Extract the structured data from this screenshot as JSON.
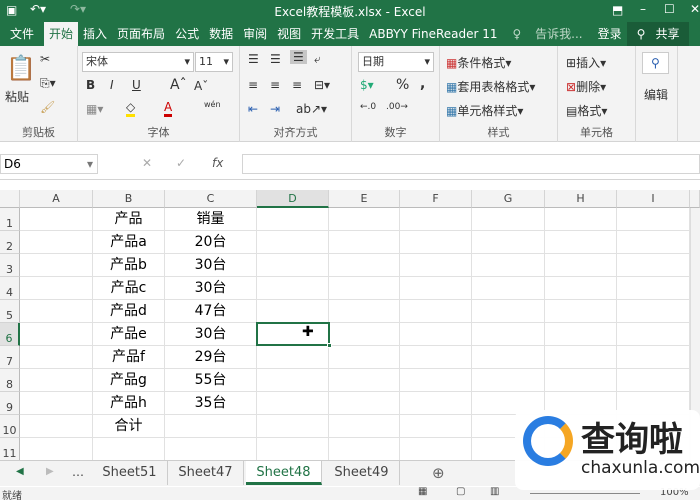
{
  "title": "Excel教程模板.xlsx - Excel",
  "tabs": [
    "文件",
    "开始",
    "插入",
    "页面布局",
    "公式",
    "数据",
    "审阅",
    "视图",
    "开发工具",
    "ABBYY FineReader 11",
    "告诉我...",
    "登录",
    "共享"
  ],
  "ribbon": {
    "clipboard": {
      "paste": "粘贴",
      "label": "剪贴板"
    },
    "font": {
      "name": "宋体",
      "size": "11",
      "label": "字体",
      "bold": "B",
      "italic": "I",
      "underline": "U",
      "phonetic": "wén"
    },
    "align": {
      "label": "对齐方式"
    },
    "number": {
      "format": "日期",
      "percent": "%",
      "comma": ",",
      "label": "数字"
    },
    "styles": {
      "cond": "条件格式",
      "table": "套用表格格式",
      "cell": "单元格样式",
      "label": "样式"
    },
    "cells": {
      "insert": "插入",
      "delete": "删除",
      "format": "格式",
      "label": "单元格"
    },
    "edit": {
      "label": "编辑"
    }
  },
  "formula": {
    "name_box": "D6",
    "fx": "fx",
    "value": ""
  },
  "columns": [
    "A",
    "B",
    "C",
    "D",
    "E",
    "F",
    "G",
    "H",
    "I"
  ],
  "rows": [
    "1",
    "2",
    "3",
    "4",
    "5",
    "6",
    "7",
    "8",
    "9",
    "10",
    "11"
  ],
  "data": [
    [
      "产品",
      "销量"
    ],
    [
      "产品a",
      "20台"
    ],
    [
      "产品b",
      "30台"
    ],
    [
      "产品c",
      "30台"
    ],
    [
      "产品d",
      "47台"
    ],
    [
      "产品e",
      "30台"
    ],
    [
      "产品f",
      "29台"
    ],
    [
      "产品g",
      "55台"
    ],
    [
      "产品h",
      "35台"
    ],
    [
      "合计",
      ""
    ]
  ],
  "selected_cell": "D6",
  "sheets": [
    "Sheet51",
    "Sheet47",
    "Sheet48",
    "Sheet49"
  ],
  "active_sheet": "Sheet48",
  "status": {
    "text": "就绪",
    "zoom": "100%"
  },
  "watermark": {
    "name": "查询啦",
    "url": "chaxunla.com"
  }
}
